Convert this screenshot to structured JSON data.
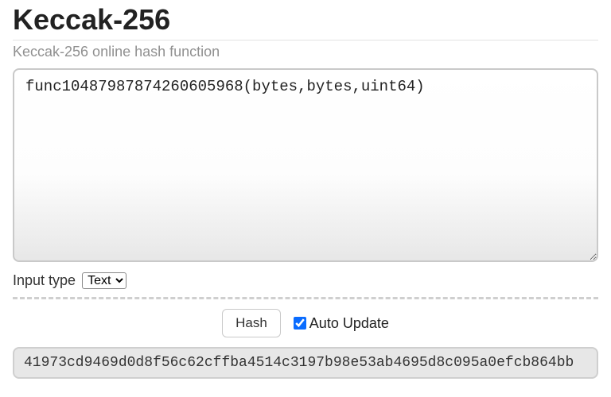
{
  "header": {
    "title": "Keccak-256",
    "subtitle": "Keccak-256 online hash function"
  },
  "input": {
    "value": "func10487987874260605968(bytes,bytes,uint64)",
    "type_label": "Input type",
    "type_selected": "Text"
  },
  "actions": {
    "hash_label": "Hash",
    "auto_update_label": "Auto Update",
    "auto_update_checked": true
  },
  "output": {
    "hash": "41973cd9469d0d8f56c62cffba4514c3197b98e53ab4695d8c095a0efcb864bb"
  }
}
